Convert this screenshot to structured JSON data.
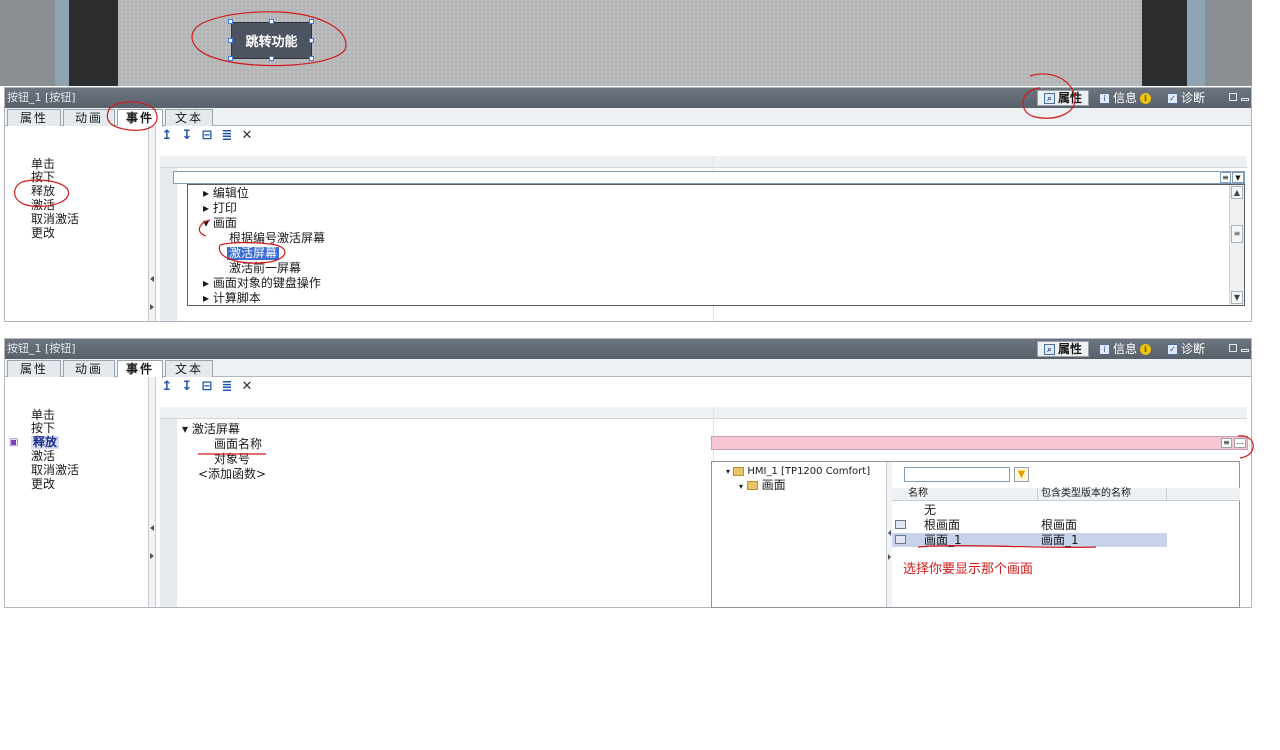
{
  "hmi": {
    "button_label": "跳转功能"
  },
  "panel_title": "按钮_1 [按钮]",
  "inspector_tabs": {
    "properties": "属性",
    "info": "信息",
    "diagnostics": "诊断"
  },
  "tabs": {
    "properties": "属性",
    "animation": "动画",
    "events": "事件",
    "text": "文本"
  },
  "events": [
    "单击",
    "按下",
    "释放",
    "激活",
    "取消激活",
    "更改"
  ],
  "toolbar": {
    "up": "↥",
    "down": "↧",
    "collapse": "⊟",
    "list": "≣",
    "delete": "✕"
  },
  "function_list": {
    "items": [
      "编辑位",
      "打印",
      "画面",
      "根据编号激活屏幕",
      "激活屏幕",
      "激活前一屏幕",
      "画面对象的键盘操作",
      "计算脚本"
    ]
  },
  "function_detail": {
    "function": "激活屏幕",
    "params": [
      "画面名称",
      "对象号"
    ],
    "add_function": "<添加函数>"
  },
  "picker": {
    "root": "HMI_1 [TP1200 Comfort]",
    "folder": "画面",
    "col_name": "名称",
    "col_type": "包含类型版本的名称",
    "rows": [
      {
        "name": "无",
        "type": ""
      },
      {
        "name": "根画面",
        "type": "根画面"
      },
      {
        "name": "画面_1",
        "type": "画面_1"
      }
    ],
    "hint": "选择你要显示那个画面"
  },
  "colors": {
    "selection": "#3d6bd6",
    "pink_field": "#f7c6d3",
    "annotation": "#d21a1a"
  }
}
